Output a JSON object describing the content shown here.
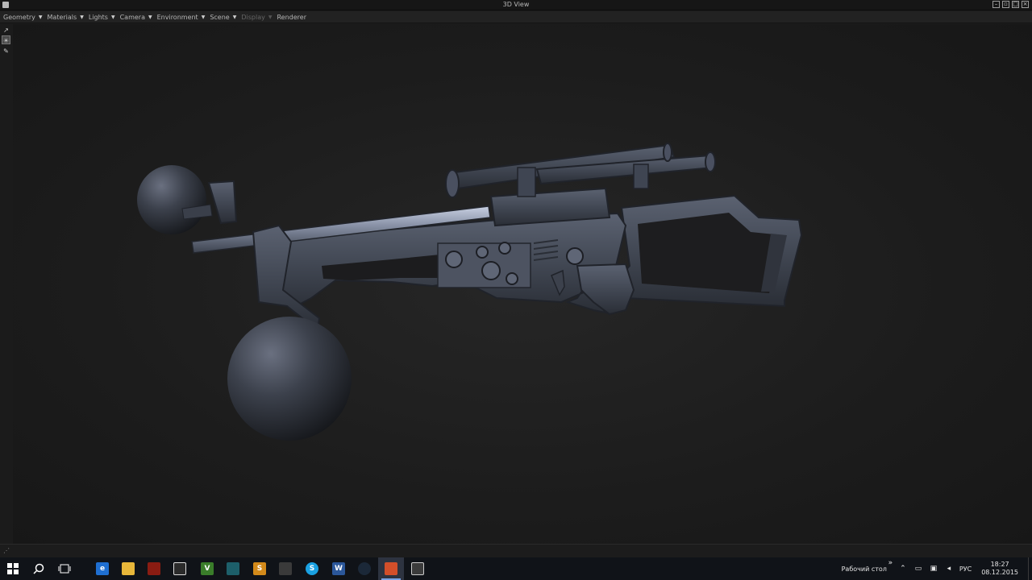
{
  "window": {
    "title": "3D View"
  },
  "menu": [
    {
      "label": "Geometry",
      "disabled": false
    },
    {
      "label": "Materials",
      "disabled": false
    },
    {
      "label": "Lights",
      "disabled": false
    },
    {
      "label": "Camera",
      "disabled": false
    },
    {
      "label": "Environment",
      "disabled": false
    },
    {
      "label": "Scene",
      "disabled": false
    },
    {
      "label": "Display",
      "disabled": true
    },
    {
      "label": "Renderer",
      "disabled": false
    }
  ],
  "tools": [
    {
      "icon": "export-icon"
    },
    {
      "icon": "rotate-light-icon"
    },
    {
      "icon": "pick-icon"
    }
  ],
  "viewport": {
    "model": "rifle-with-spheres",
    "colors": {
      "background": "#1b1b1b",
      "metal": "#4a5160",
      "highlight": "#9aa4b8"
    }
  },
  "taskbar": {
    "apps": [
      {
        "name": "edge-icon",
        "glyph": "e",
        "color": "#1f6fd1"
      },
      {
        "name": "file-explorer-icon",
        "glyph": "",
        "color": "#e8b73a"
      },
      {
        "name": "dota-icon",
        "glyph": "",
        "color": "#8a1c12"
      },
      {
        "name": "store-icon",
        "glyph": "",
        "color": "#2b2b2b"
      },
      {
        "name": "vray-icon",
        "glyph": "V",
        "color": "#3a7d2a"
      },
      {
        "name": "zbrush-icon",
        "glyph": "",
        "color": "#1d5f6a"
      },
      {
        "name": "paint-app-icon",
        "glyph": "S",
        "color": "#d38a1a"
      },
      {
        "name": "apps-grid-icon",
        "glyph": "",
        "color": "#3a3a3a"
      },
      {
        "name": "skype-icon",
        "glyph": "S",
        "color": "#1aa1e2"
      },
      {
        "name": "word-icon",
        "glyph": "W",
        "color": "#2b579a"
      },
      {
        "name": "steam-icon",
        "glyph": "",
        "color": "#1b2838"
      },
      {
        "name": "substance-painter-icon",
        "glyph": "",
        "color": "#d34f2a"
      },
      {
        "name": "calculator-icon",
        "glyph": "",
        "color": "#3b3b3b"
      }
    ],
    "active_app": "substance-painter-icon",
    "tray": {
      "desktop_label": "Рабочий стол",
      "chevron": "»",
      "language": "РУС",
      "time": "18:27",
      "date": "08.12.2015"
    }
  }
}
